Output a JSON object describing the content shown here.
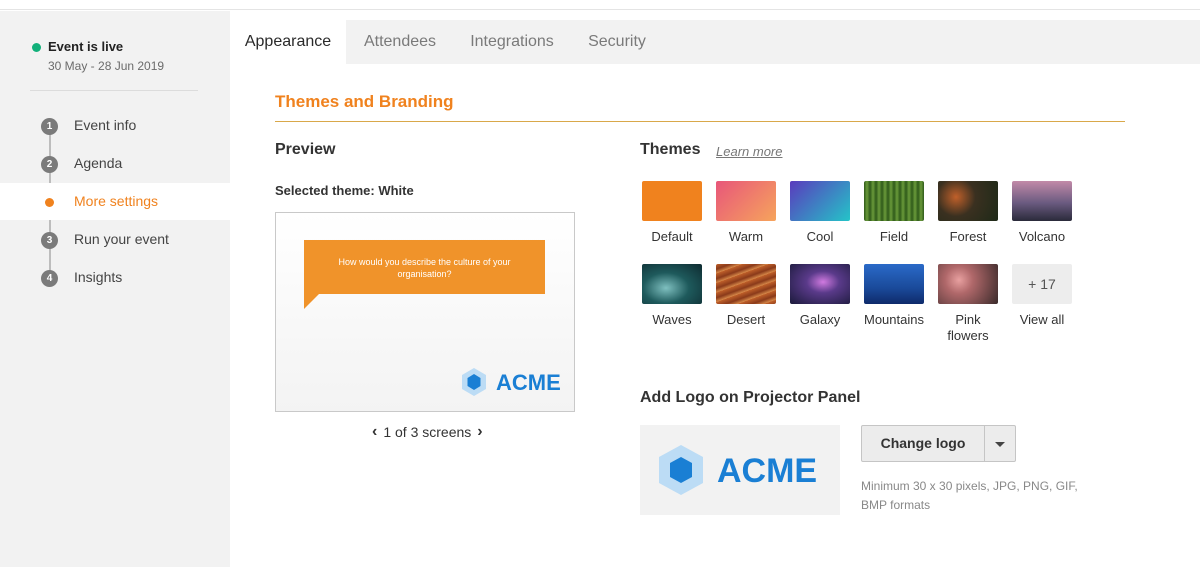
{
  "sidebar": {
    "status_title": "Event is live",
    "status_dates": "30 May - 28 Jun 2019",
    "steps": [
      {
        "num": "1",
        "label": "Event info"
      },
      {
        "num": "2",
        "label": "Agenda"
      },
      {
        "num": "",
        "label": "More settings"
      },
      {
        "num": "3",
        "label": "Run your event"
      },
      {
        "num": "4",
        "label": "Insights"
      }
    ]
  },
  "tabs": [
    {
      "label": "Appearance"
    },
    {
      "label": "Attendees"
    },
    {
      "label": "Integrations"
    },
    {
      "label": "Security"
    }
  ],
  "main": {
    "section_title": "Themes and Branding",
    "preview": {
      "title": "Preview",
      "selected_theme": "Selected theme: White",
      "question": "How would you describe the culture of your organisation?",
      "logo_text": "ACME",
      "pager": "1 of 3 screens"
    },
    "themes": {
      "title": "Themes",
      "learn_more": "Learn more",
      "items": [
        {
          "label": "Default",
          "color": "#f0821e"
        },
        {
          "label": "Warm",
          "color": "#f09060"
        },
        {
          "label": "Cool",
          "color": "#2fb5c8"
        },
        {
          "label": "Field",
          "color": "#4d7a2a"
        },
        {
          "label": "Forest",
          "color": "#3a3a2a"
        },
        {
          "label": "Volcano",
          "color": "#6b5a72"
        },
        {
          "label": "Waves",
          "color": "#1e5a5c"
        },
        {
          "label": "Desert",
          "color": "#a0502a"
        },
        {
          "label": "Galaxy",
          "color": "#3a2a5a"
        },
        {
          "label": "Mountains",
          "color": "#1a4a9a"
        },
        {
          "label": "Pink flowers",
          "color": "#b0686a"
        },
        {
          "label": "View all",
          "count": "+ 17"
        }
      ]
    },
    "logo": {
      "title": "Add Logo on Projector Panel",
      "logo_text": "ACME",
      "change_label": "Change logo",
      "hint": "Minimum 30 x 30 pixels, JPG, PNG, GIF, BMP formats"
    }
  }
}
